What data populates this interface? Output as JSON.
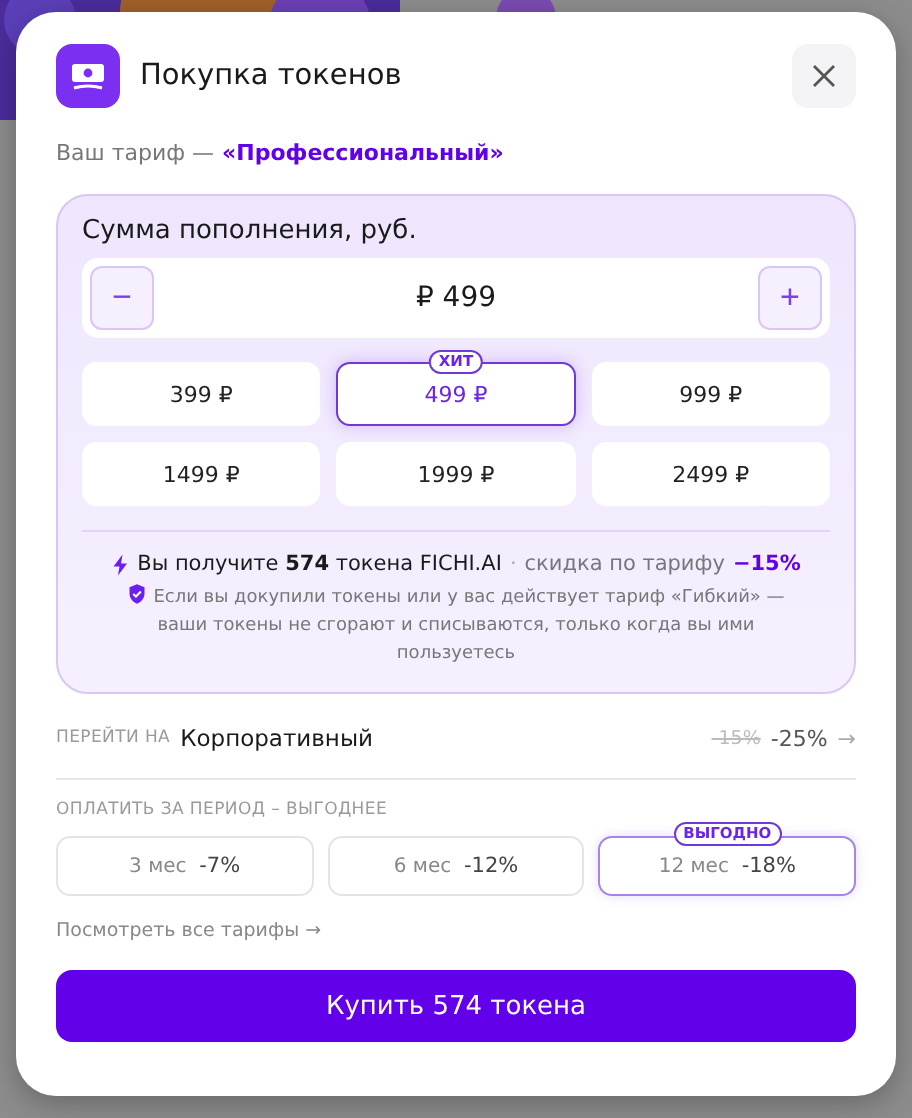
{
  "dialog": {
    "title": "Покупка токенов",
    "tariff_label": "Ваш тариф —",
    "tariff_name": "«Профессиональный»"
  },
  "amount": {
    "label": "Сумма пополнения, руб.",
    "minus": "−",
    "plus": "+",
    "value": "₽ 499",
    "presets": [
      {
        "label": "399 ₽",
        "selected": false
      },
      {
        "label": "499 ₽",
        "selected": true,
        "badge": "ХИТ"
      },
      {
        "label": "999 ₽",
        "selected": false
      },
      {
        "label": "1499 ₽",
        "selected": false
      },
      {
        "label": "1999 ₽",
        "selected": false
      },
      {
        "label": "2499 ₽",
        "selected": false
      }
    ]
  },
  "summary": {
    "text": "Вы получите **574** токена FICHI.AI",
    "separator": "·",
    "discount_label": "скидка по тарифу",
    "discount": "−15%",
    "note": "Если вы докупили токены или у вас действует тариф «Гибкий» — ваши токены не сгорают и списываются, только когда вы ими пользуетесь"
  },
  "upgrade": {
    "label": "ПЕРЕЙТИ НА",
    "plan": "Корпоративный",
    "old_discount": "-15%",
    "new_discount": "-25%",
    "arrow": "→"
  },
  "periods": {
    "label": "ОПЛАТИТЬ ЗА ПЕРИОД – ВЫГОДНЕЕ",
    "items": [
      {
        "months": "3 мес",
        "discount": "-7%",
        "selected": false
      },
      {
        "months": "6 мес",
        "discount": "-12%",
        "selected": false
      },
      {
        "months": "12 мес",
        "discount": "-18%",
        "selected": true,
        "badge": "ВЫГОДНО"
      }
    ]
  },
  "all_plans_link": "Посмотреть все тарифы →",
  "buy_button": "Купить 574 токена"
}
